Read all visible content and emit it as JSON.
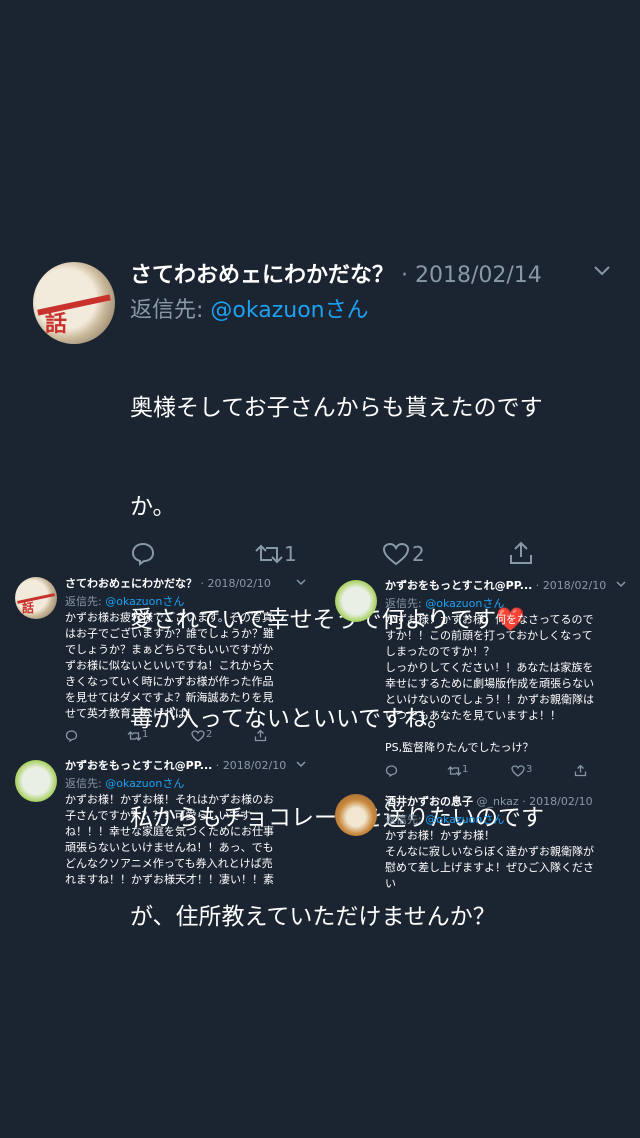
{
  "main": {
    "name": "さてわおめェにわかだな？",
    "date": "2018/02/14",
    "reply_prefix": "返信先:",
    "reply_handle": "@okazuonさん",
    "body_lines": [
      "奥様そしてお子さんからも貰えたのです",
      "か。",
      "愛されていて幸せそうで何よりです",
      "毒が入ってないといいですね。",
      "私からもチョコレートを送りたいのです",
      "が、住所教えていただけませんか？"
    ],
    "heart_emoji": "❤️",
    "retweets": "1",
    "likes": "2"
  },
  "t1": {
    "name": "さてわおめェにわかだな？",
    "date": "2018/02/10",
    "reply_prefix": "返信先:",
    "reply_handle": "@okazuonさん",
    "body": "かずお様お疲れ様でございます。その写真\nはお子でございますか？誰でしょうか？雖\nでしょうか？まぁどちらでもいいですがか\nずお様に似ないといいですね！これから大\nきくなっていく時にかずお様が作った作品\nを見せてはダメですよ？新海誠あたりを見\nせて英才教育しなければ！",
    "retweets": "1",
    "likes": "2"
  },
  "t2": {
    "name": "かずおをもっとすこれ@PP...",
    "date": "2018/02/10",
    "reply_prefix": "返信先:",
    "reply_handle": "@okazuonさん",
    "body": "かずお様！かずお様！何をなさってるので\nすか！！この前頭を打っておかしくなって\nしまったのですか！？\nしっかりしてください！！あなたは家族を\n幸せにするために劇場版作成を頑張らない\nといけないのでしょう！！かずお親衛隊は\nいつでもあなたを見ていますよ！！\n\nPS,監督降りたんでしたっけ？",
    "retweets": "1",
    "likes": "3"
  },
  "t3": {
    "name": "かずおをもっとすこれ@PP...",
    "date": "2018/02/10",
    "reply_prefix": "返信先:",
    "reply_handle": "@okazuonさん",
    "body": "かずお様！かずお様！それはかずお様のお\n子さんですか？？？？可愛らしいです\nね！！！幸せな家庭を気づくためにお仕事\n頑張らないといけませんね！！あっ、でも\nどんなクソアニメ作っても券入れとけば売\nれますね！！かずお様天才！！凄い！！素"
  },
  "t4": {
    "name": "酒井かずおの息子",
    "handle": "@_nkaz",
    "date": "2018/02/10",
    "reply_prefix": "返信先:",
    "reply_handle": "@okazuonさん",
    "body": "かずお様！かずお様！\nそんなに寂しいならぼく達かずお親衛隊が\n慰めて差し上げますよ！ぜひご入隊くださ\nい"
  },
  "avatar_sign_text": "話",
  "icons": {
    "reply": "reply-icon",
    "retweet": "retweet-icon",
    "like": "heart-icon",
    "share": "share-icon",
    "more": "chevron-down-icon"
  },
  "colors": {
    "background": "#1b2431",
    "meta": "#8899a6",
    "link": "#1da1f2",
    "heart": "#e0245e"
  }
}
